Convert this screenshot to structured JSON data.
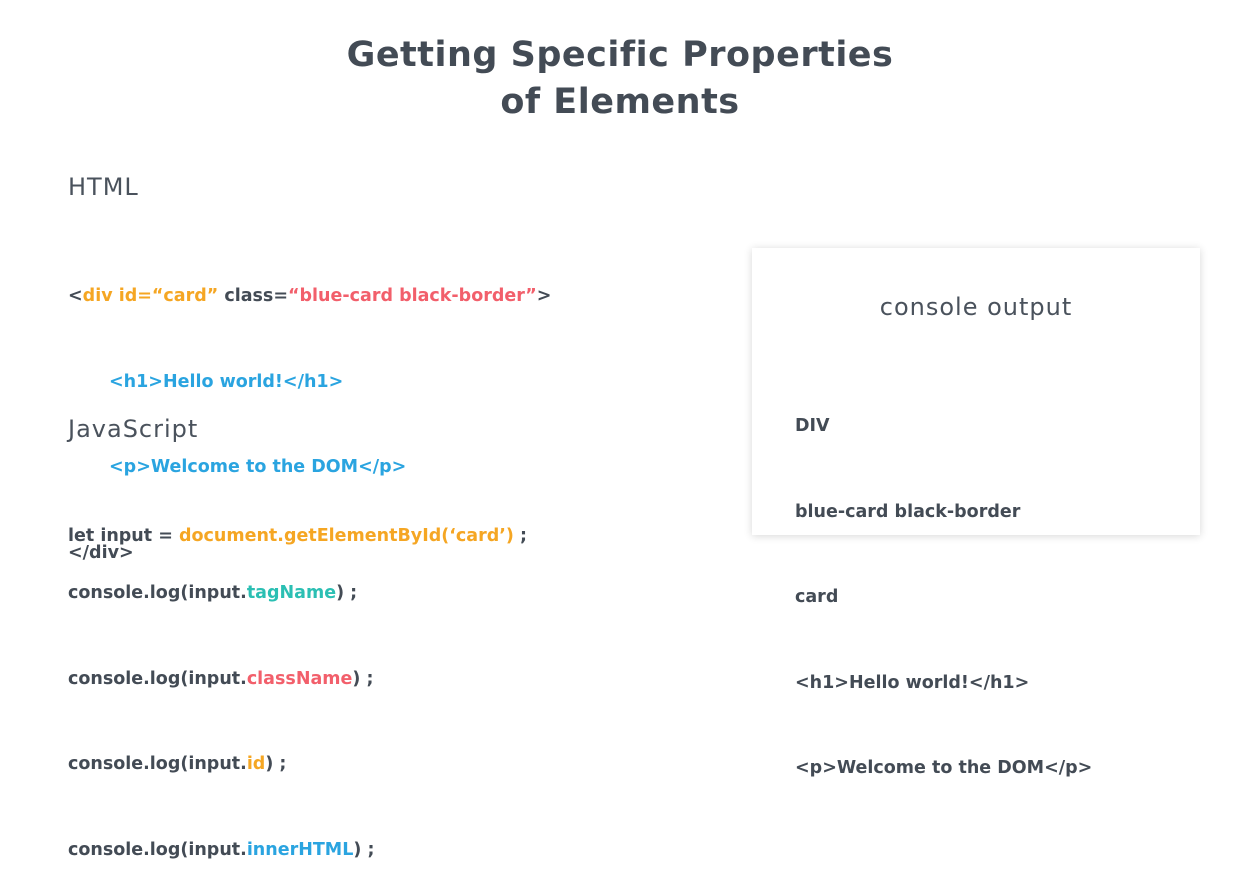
{
  "title": {
    "line1": "Getting Specific Properties",
    "line2": "of Elements"
  },
  "html_section": {
    "label": "HTML",
    "lines": [
      [
        {
          "t": "<",
          "c": "dark"
        },
        {
          "t": "div",
          "c": "orange"
        },
        {
          "t": " ",
          "c": "dark"
        },
        {
          "t": "id=“card”",
          "c": "orange"
        },
        {
          "t": " class=",
          "c": "dark"
        },
        {
          "t": "“blue-card black-border”",
          "c": "red"
        },
        {
          "t": ">",
          "c": "dark"
        }
      ],
      [
        {
          "t": "<h1>Hello world!</h1>",
          "c": "blue"
        }
      ],
      [
        {
          "t": "<p>Welcome to the DOM</p>",
          "c": "blue"
        }
      ],
      [
        {
          "t": "</div>",
          "c": "dark"
        }
      ]
    ]
  },
  "js_section": {
    "label": "JavaScript",
    "declaration": [
      {
        "t": "let input = ",
        "c": "dark"
      },
      {
        "t": "document.getElementById(‘card’)",
        "c": "orange"
      },
      {
        "t": " ;",
        "c": "dark"
      }
    ],
    "logs": [
      [
        {
          "t": "console.log(input.",
          "c": "dark"
        },
        {
          "t": "tagName",
          "c": "teal"
        },
        {
          "t": ") ;",
          "c": "dark"
        }
      ],
      [
        {
          "t": "console.log(input.",
          "c": "dark"
        },
        {
          "t": "className",
          "c": "red"
        },
        {
          "t": ") ;",
          "c": "dark"
        }
      ],
      [
        {
          "t": "console.log(input.",
          "c": "dark"
        },
        {
          "t": "id",
          "c": "orange"
        },
        {
          "t": ") ;",
          "c": "dark"
        }
      ],
      [
        {
          "t": "console.log(input.",
          "c": "dark"
        },
        {
          "t": "innerHTML",
          "c": "blue"
        },
        {
          "t": ") ;",
          "c": "dark"
        }
      ]
    ]
  },
  "console": {
    "title": "console output",
    "lines": [
      "DIV",
      "blue-card black-border",
      "card",
      "<h1>Hello world!</h1>",
      "<p>Welcome to the DOM</p>"
    ]
  },
  "colors": {
    "dark": "#434b55",
    "orange": "#f5a623",
    "red": "#f25f6b",
    "blue": "#2aa4e0",
    "teal": "#2bbfb3"
  }
}
